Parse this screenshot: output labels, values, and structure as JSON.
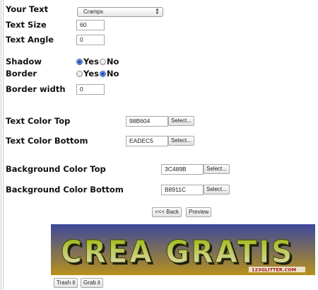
{
  "form": {
    "your_text": {
      "label": "Your Text",
      "selected_font": "Cramps"
    },
    "text_size": {
      "label": "Text Size",
      "value": "60"
    },
    "text_angle": {
      "label": "Text Angle",
      "value": "0"
    },
    "shadow": {
      "label": "Shadow",
      "yes": "Yes",
      "no": "No",
      "selected": "Yes"
    },
    "border": {
      "label": "Border",
      "yes": "Yes",
      "no": "No",
      "selected": "No"
    },
    "border_width": {
      "label": "Border width",
      "value": "0"
    },
    "text_color_top": {
      "label": "Text Color Top",
      "value": "98B604",
      "button": "Select..."
    },
    "text_color_bottom": {
      "label": "Text Color Bottom",
      "value": "EADEC5",
      "button": "Select..."
    },
    "bg_color_top": {
      "label": "Background Color Top",
      "value": "3C489B",
      "button": "Select..."
    },
    "bg_color_bottom": {
      "label": "Background Color Bottom",
      "value": "B8911C",
      "button": "Select..."
    }
  },
  "actions": {
    "back": "<<< Back",
    "preview": "Preview",
    "trash": "Trash it",
    "grab": "Grab it"
  },
  "preview_image": {
    "text": "CREA GRATIS",
    "watermark": "123GLITTER.COM",
    "text_color_top": "#98B604",
    "text_color_bottom": "#EADEC5",
    "bg_color_top": "#3C489B",
    "bg_color_bottom": "#B8911C"
  }
}
